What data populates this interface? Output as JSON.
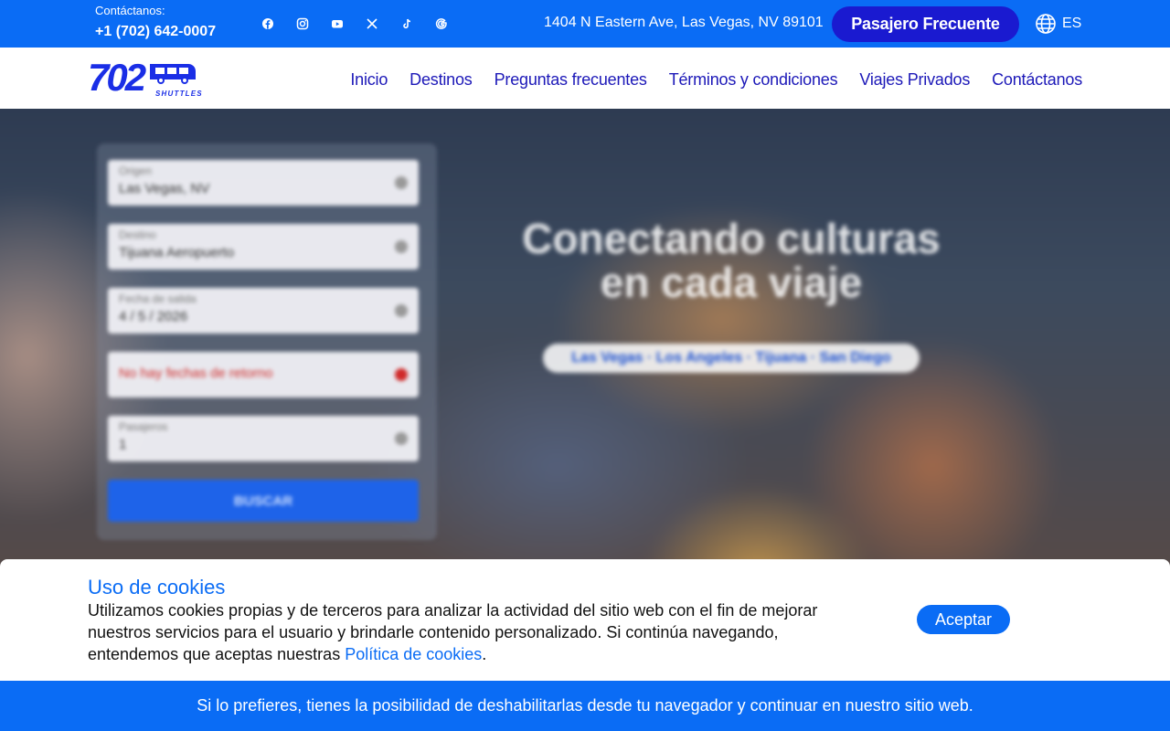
{
  "topbar": {
    "contact_label": "Contáctanos:",
    "phone": "+1 (702) 642-0007",
    "socials": [
      "facebook-icon",
      "instagram-icon",
      "youtube-icon",
      "x-icon",
      "tiktok-icon",
      "google-icon"
    ],
    "address": "1404 N Eastern Ave, Las Vegas, NV 89101",
    "frequent_button": "Pasajero Frecuente",
    "language": "ES"
  },
  "logo": {
    "number": "702",
    "subtitle": "SHUTTLES"
  },
  "nav": {
    "items": [
      "Inicio",
      "Destinos",
      "Preguntas frecuentes",
      "Términos y condiciones",
      "Viajes Privados",
      "Contáctanos"
    ]
  },
  "hero": {
    "title_line1": "Conectando culturas",
    "title_line2": "en cada viaje",
    "routes": "Las Vegas · Los Angeles · Tijuana · San Diego"
  },
  "form": {
    "origin_label": "Origen",
    "origin_value": "Las Vegas, NV",
    "destination_label": "Destino",
    "destination_value": "Tijuana Aeropuerto",
    "date_label": "Fecha de salida",
    "date_value": "4 / 5 / 2026",
    "return_value": "No hay fechas de retorno",
    "passengers_label": "Pasajeros",
    "passengers_value": "1",
    "search_button": "BUSCAR"
  },
  "cookies": {
    "title": "Uso de cookies",
    "text": "Utilizamos cookies propias y de terceros para analizar la actividad del sitio web con el fin de mejorar nuestros servicios para el usuario y brindarle contenido personalizado. Si continúa navegando, entendemos que aceptas nuestras ",
    "policy_link": "Política de cookies",
    "text_end": ".",
    "accept_button": "Aceptar",
    "footer_note": "Si lo prefieres, tienes la posibilidad de deshabilitarlas desde tu navegador y continuar en nuestro sitio web."
  },
  "colors": {
    "primary": "#0a6cf5",
    "nav_text": "#1c18b8",
    "frequent_button": "#1a1ad0"
  }
}
